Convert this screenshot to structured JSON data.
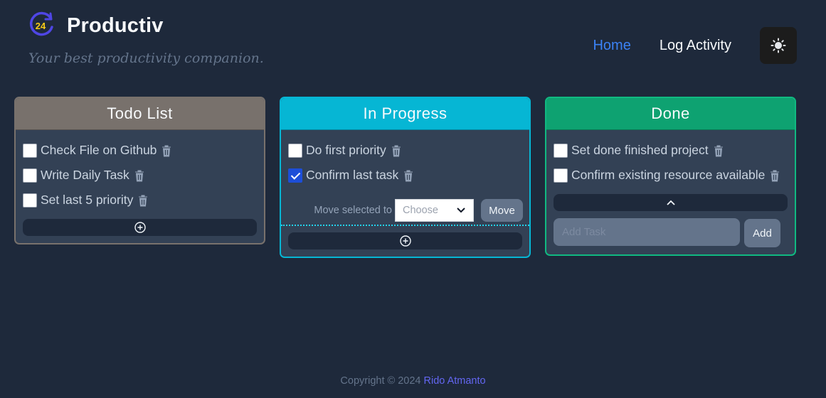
{
  "header": {
    "logo_text": "24",
    "title": "Productiv",
    "tagline": "Your best productivity companion.",
    "nav": [
      {
        "label": "Home",
        "active": true
      },
      {
        "label": "Log Activity",
        "active": false
      }
    ],
    "theme_icon": "sun-icon"
  },
  "columns": {
    "todo": {
      "title": "Todo List",
      "color": "#78716c",
      "tasks": [
        {
          "label": "Check File on Github",
          "checked": false
        },
        {
          "label": "Write Daily Task",
          "checked": false
        },
        {
          "label": "Set last 5 priority",
          "checked": false
        }
      ],
      "add_icon": "plus-circle-icon"
    },
    "progress": {
      "title": "In Progress",
      "color": "#06b6d4",
      "tasks": [
        {
          "label": "Do first priority",
          "checked": false
        },
        {
          "label": "Confirm last task",
          "checked": true
        }
      ],
      "move_label": "Move selected to",
      "move_select_value": "Choose",
      "move_button": "Move",
      "add_icon": "plus-circle-icon"
    },
    "done": {
      "title": "Done",
      "color": "#10b981",
      "tasks": [
        {
          "label": "Set done finished project",
          "checked": false
        },
        {
          "label": "Confirm existing resource available",
          "checked": false
        }
      ],
      "collapse_icon": "chevron-up-icon",
      "input_placeholder": "Add Task",
      "add_button": "Add"
    }
  },
  "footer": {
    "copyright": "Copyright © 2024 ",
    "author": "Rido Atmanto"
  }
}
